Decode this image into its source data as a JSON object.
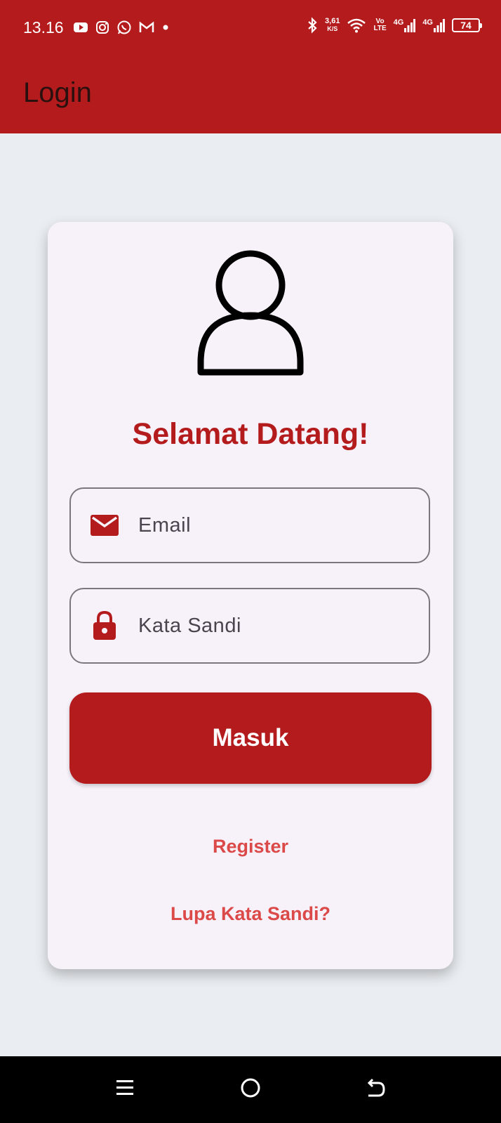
{
  "status_bar": {
    "time": "13.16",
    "speed_value": "3,61",
    "speed_unit": "K/S",
    "volte_top": "Vo",
    "volte_bottom": "LTE",
    "network_1": "4G",
    "network_2": "4G",
    "battery": "74"
  },
  "app_bar": {
    "title": "Login"
  },
  "login_card": {
    "welcome": "Selamat Datang!",
    "email_placeholder": "Email",
    "password_placeholder": "Kata Sandi",
    "login_button": "Masuk",
    "register_link": "Register",
    "forgot_link": "Lupa Kata Sandi?"
  },
  "icons": {
    "avatar": "person-outline-icon",
    "email": "mail-icon",
    "password": "lock-icon"
  },
  "colors": {
    "primary": "#b41b1d",
    "link": "#db4a48",
    "background": "#eaeef2",
    "card": "#f7f2fa"
  }
}
